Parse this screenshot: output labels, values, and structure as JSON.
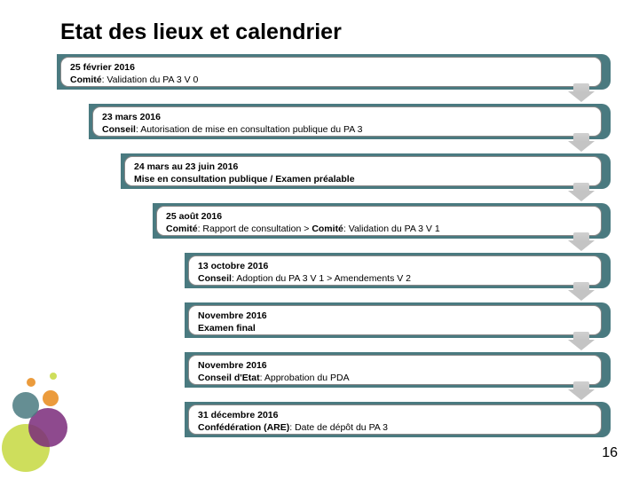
{
  "title": "Etat des lieux et calendrier",
  "page_number": "16",
  "steps": [
    {
      "date": "25 février 2016",
      "body_html": "<b>Comité</b>: Validation du PA 3 V 0",
      "indent": 0
    },
    {
      "date": "23 mars 2016",
      "body_html": "<b>Conseil</b>: Autorisation de mise en consultation publique du PA 3",
      "indent": 36
    },
    {
      "date": "24 mars au 23 juin 2016",
      "body_html": "<b>Mise en consultation publique / Examen préalable</b>",
      "indent": 72
    },
    {
      "date": "25 août 2016",
      "body_html": "<b>Comité</b>: Rapport de consultation > <b>Comité</b>: Validation du PA 3 V 1",
      "indent": 108
    },
    {
      "date": "13 octobre 2016",
      "body_html": "<b>Conseil</b>: Adoption du PA 3 V 1 > Amendements V 2",
      "indent": 144
    },
    {
      "date": "Novembre 2016",
      "body_html": "<b>Examen final</b>",
      "indent": 144
    },
    {
      "date": "Novembre 2016",
      "body_html": "<b>Conseil d'Etat</b>: Approbation du PDA",
      "indent": 144
    },
    {
      "date": "31 décembre 2016",
      "body_html": "<b>Confédération (ARE)</b>: Date de dépôt du PA 3",
      "indent": 144
    }
  ],
  "colors": {
    "band": "#4a7a80"
  }
}
